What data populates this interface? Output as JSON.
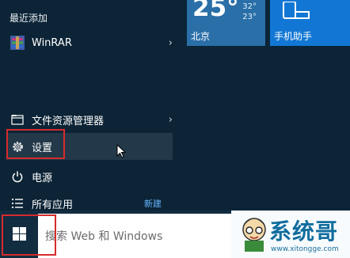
{
  "start_menu": {
    "recent_title": "最近添加",
    "apps": [
      {
        "label": "WinRAR",
        "chevron": "›"
      },
      {
        "label": "文件资源管理器",
        "chevron": "›"
      },
      {
        "label": "设置"
      },
      {
        "label": "电源"
      },
      {
        "label": "所有应用",
        "badge": "新建"
      }
    ]
  },
  "tiles": {
    "weather": {
      "temp_big": "25°",
      "temp_high": "32°",
      "temp_low": "23°",
      "label": "北京"
    },
    "phone_assistant": {
      "label": "手机助手"
    }
  },
  "taskbar": {
    "search_placeholder": "搜索 Web 和 Windows"
  },
  "watermark": {
    "name": "系统哥",
    "url": "www.xitongge.com"
  },
  "colors": {
    "menu_bg": "#0c2436",
    "selected_row": "#233949",
    "highlight_border": "#d62b2b",
    "weather_tile": "#2a6fa8",
    "phone_tile": "#1277d4",
    "badge_blue": "#65b4ff"
  },
  "icons": [
    "winrar-icon",
    "folder-icon",
    "gear-icon",
    "power-icon",
    "list-icon",
    "windows-logo-icon",
    "phone-icon",
    "mouse-cursor-icon"
  ]
}
